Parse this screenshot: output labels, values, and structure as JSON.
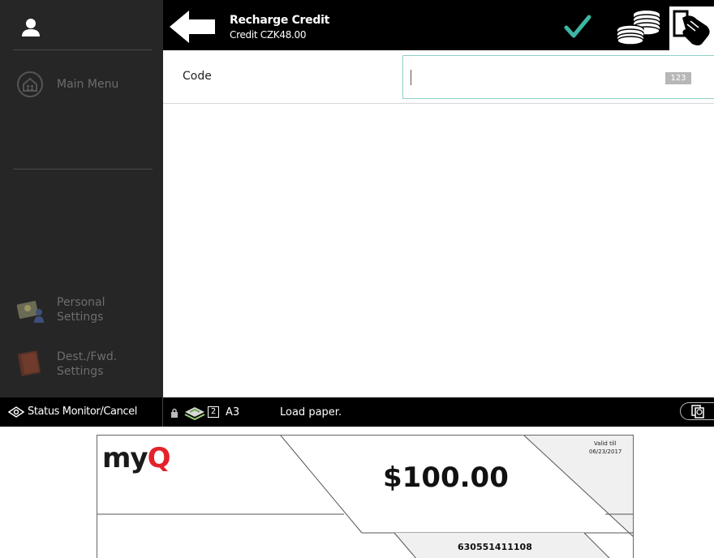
{
  "header": {
    "title": "Recharge Credit",
    "subtitle": "Credit CZK48.00"
  },
  "sidebar": {
    "items": [
      {
        "label": "Main Menu",
        "icon": "home-icon"
      },
      {
        "label_line1": "Personal",
        "label_line2": "Settings",
        "icon": "personal-settings-icon"
      },
      {
        "label_line1": "Dest./Fwd.",
        "label_line2": "Settings",
        "icon": "address-book-icon"
      }
    ]
  },
  "form": {
    "code_label": "Code",
    "code_value": "",
    "keyboard_badge": "123"
  },
  "statusbar": {
    "status_monitor_label": "Status Monitor/Cancel",
    "tray_number": "2",
    "paper_size": "A3",
    "message": "Load paper."
  },
  "voucher": {
    "logo_prefix": "my",
    "logo_accent": "Q",
    "amount": "$100.00",
    "valid_label": "Valid till",
    "valid_date": "06/23/2017",
    "serial": "630551411108"
  },
  "colors": {
    "sidebar_bg": "#262626",
    "topbar_bg": "#000000",
    "accent_check": "#3fb6a4",
    "input_border": "#8fd0c6",
    "logo_red": "#e4222b"
  }
}
